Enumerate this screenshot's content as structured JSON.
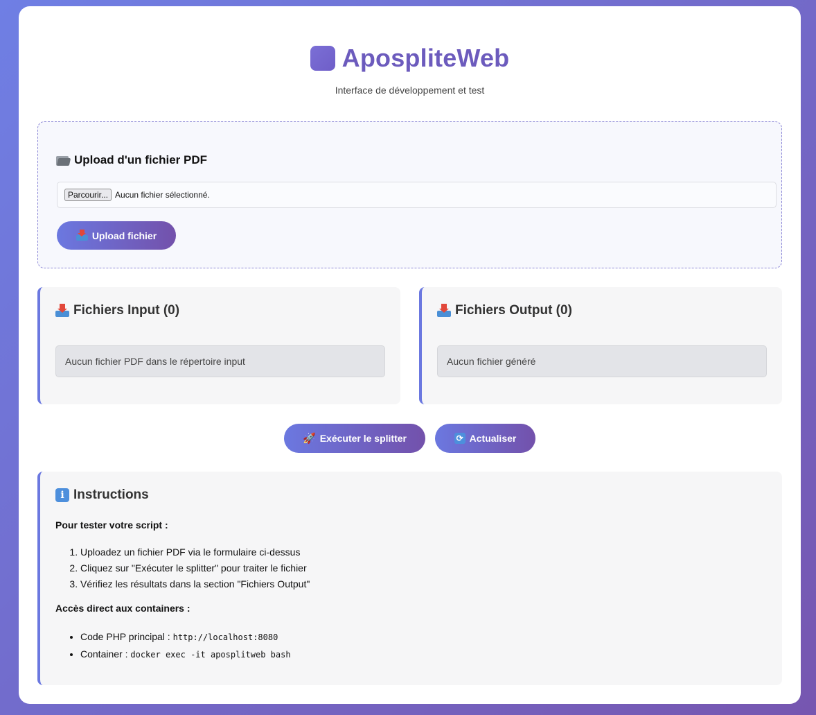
{
  "header": {
    "title": "ApospliteWeb",
    "subtitle": "Interface de développement et test"
  },
  "upload": {
    "title": "Upload d'un fichier PDF",
    "browse_label": "Parcourir...",
    "no_file_text": "Aucun fichier sélectionné.",
    "button_label": "Upload fichier"
  },
  "panels": {
    "input": {
      "title": "Fichiers Input (0)",
      "empty_text": "Aucun fichier PDF dans le répertoire input"
    },
    "output": {
      "title": "Fichiers Output (0)",
      "empty_text": "Aucun fichier généré"
    }
  },
  "actions": {
    "run_label": "Exécuter le splitter",
    "refresh_label": "Actualiser"
  },
  "instructions": {
    "title": "Instructions",
    "test_heading": "Pour tester votre script :",
    "steps": [
      "Uploadez un fichier PDF via le formulaire ci-dessus",
      "Cliquez sur \"Exécuter le splitter\" pour traiter le fichier",
      "Vérifiez les résultats dans la section \"Fichiers Output\""
    ],
    "access_heading": "Accès direct aux containers :",
    "access_items": [
      {
        "label": "Code PHP principal : ",
        "code": "http://localhost:8080"
      },
      {
        "label": "Container : ",
        "code": "docker exec -it aposplitweb bash"
      }
    ]
  },
  "icons": {
    "logo": "purple-square-icon",
    "upload_section": "folder-icon",
    "upload_button": "inbox-tray-icon",
    "input_panel": "inbox-tray-icon",
    "output_panel": "outbox-tray-icon",
    "run_button": "rocket-icon",
    "refresh_button": "refresh-icon",
    "instructions": "info-icon"
  },
  "colors": {
    "accent": "#6c5bbd",
    "gradient_start": "#6b78e0",
    "gradient_end": "#7351ab"
  }
}
